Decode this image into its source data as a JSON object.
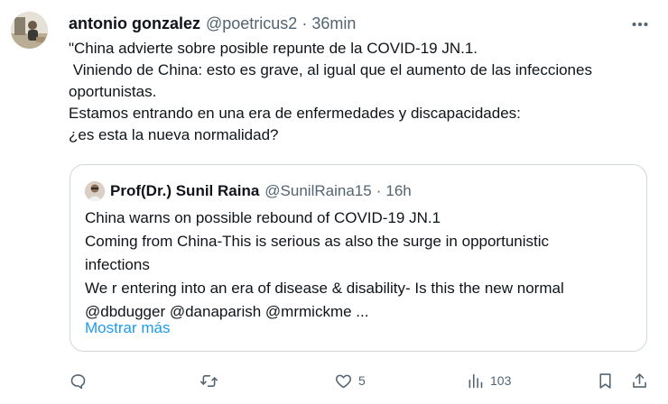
{
  "tweet": {
    "author_name": "antonio gonzalez",
    "author_handle": "@poetricus2",
    "separator": "·",
    "time": "36min",
    "lines": [
      "\"China advierte sobre posible repunte de la COVID-19 JN.1.",
      " Viniendo de China: esto es grave, al igual que el aumento de las infecciones",
      "oportunistas.",
      "Estamos entrando en una era de enfermedades y discapacidades:",
      "¿es esta la nueva normalidad?"
    ]
  },
  "quote": {
    "author_name": "Prof(Dr.) Sunil Raina",
    "author_handle": "@SunilRaina15",
    "separator": "·",
    "time": "16h",
    "lines": [
      "China warns on possible rebound of COVID-19 JN.1",
      "Coming from China-This is serious as also the surge in opportunistic",
      "infections",
      "We r entering into an era of disease & disability- Is this the new normal",
      "@dbdugger @danaparish @mrmickme ..."
    ],
    "show_more": "Mostrar más"
  },
  "actions": {
    "reply_count": "",
    "retweet_count": "",
    "like_count": "5",
    "views_count": "103"
  },
  "icons": {
    "more": "more-horizontal-icon",
    "reply": "reply-icon",
    "retweet": "retweet-icon",
    "like": "heart-icon",
    "views": "views-icon",
    "bookmark": "bookmark-icon",
    "share": "share-icon"
  },
  "colors": {
    "text": "#0f1419",
    "secondary": "#536471",
    "link": "#1d9bf0",
    "border": "#cfd9de"
  }
}
